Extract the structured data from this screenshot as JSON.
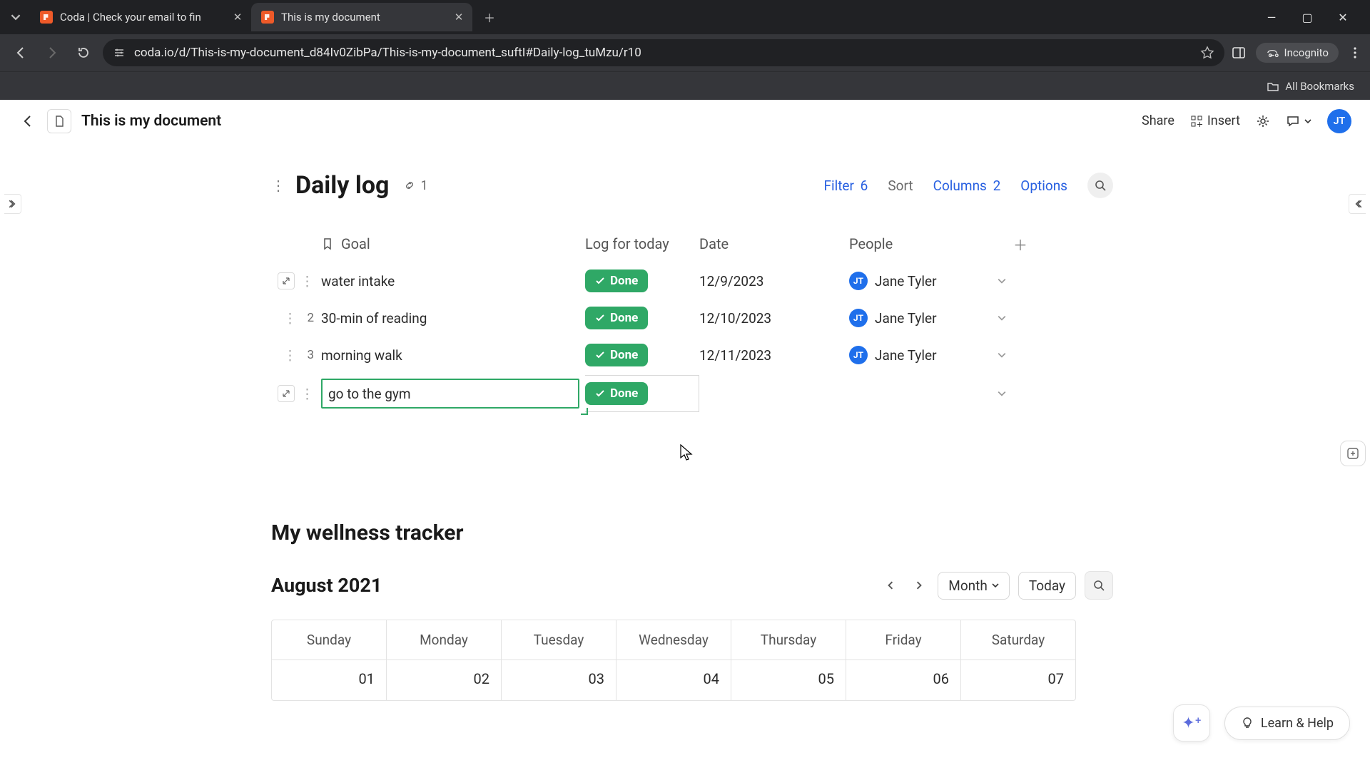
{
  "browser": {
    "tabs": [
      {
        "title": "Coda | Check your email to fin"
      },
      {
        "title": "This is my document"
      }
    ],
    "url": "coda.io/d/This-is-my-document_d84Iv0ZibPa/This-is-my-document_suftI#Daily-log_tuMzu/r10",
    "incognito": "Incognito",
    "all_bookmarks": "All Bookmarks"
  },
  "app": {
    "doc_title": "This is my document",
    "share": "Share",
    "insert": "Insert",
    "avatar": "JT"
  },
  "daily_log": {
    "title": "Daily log",
    "link_count": "1",
    "toolbar": {
      "filter": "Filter",
      "filter_n": "6",
      "sort": "Sort",
      "columns": "Columns",
      "columns_n": "2",
      "options": "Options"
    },
    "headers": {
      "goal": "Goal",
      "log": "Log for today",
      "date": "Date",
      "people": "People"
    },
    "done_label": "Done",
    "rows": [
      {
        "num": "",
        "goal": "water intake",
        "date": "12/9/2023",
        "person": "Jane Tyler",
        "initials": "JT",
        "show_expand": true,
        "editing": false
      },
      {
        "num": "2",
        "goal": "30-min of reading",
        "date": "12/10/2023",
        "person": "Jane Tyler",
        "initials": "JT",
        "show_expand": false,
        "editing": false
      },
      {
        "num": "3",
        "goal": "morning walk",
        "date": "12/11/2023",
        "person": "Jane Tyler",
        "initials": "JT",
        "show_expand": false,
        "editing": false
      },
      {
        "num": "",
        "goal": "go to the gym",
        "date": "",
        "person": "",
        "initials": "",
        "show_expand": true,
        "editing": true
      }
    ]
  },
  "tracker": {
    "title": "My wellness tracker",
    "month": "August 2021",
    "view": "Month",
    "today": "Today",
    "weekdays": [
      "Sunday",
      "Monday",
      "Tuesday",
      "Wednesday",
      "Thursday",
      "Friday",
      "Saturday"
    ],
    "daynums": [
      "01",
      "02",
      "03",
      "04",
      "05",
      "06",
      "07"
    ]
  },
  "float": {
    "learn": "Learn & Help"
  }
}
